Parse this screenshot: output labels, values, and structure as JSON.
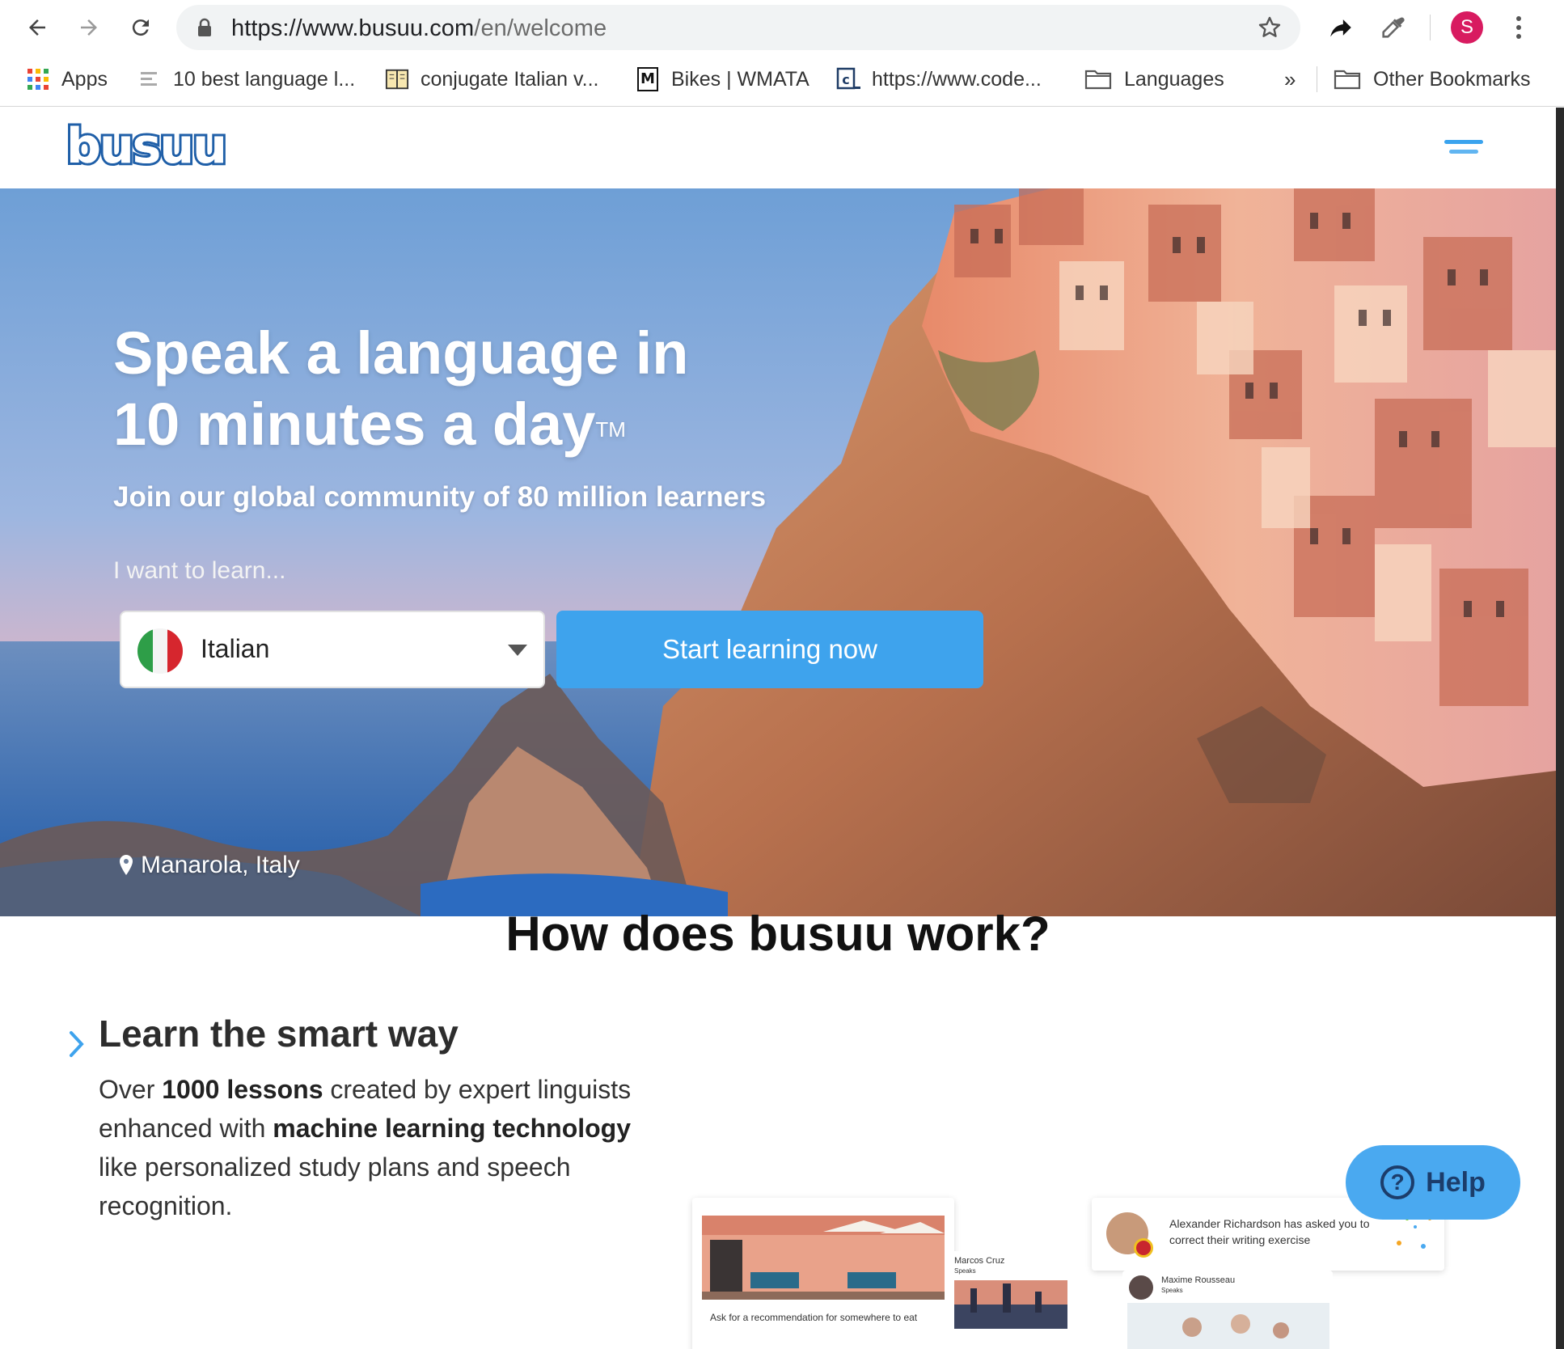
{
  "browser": {
    "url_host": "https://www.busuu.com",
    "url_path": "/en/welcome",
    "profile_initial": "S",
    "bookmarks": [
      {
        "label": "Apps",
        "icon": "apps-grid-icon"
      },
      {
        "label": "10 best language l...",
        "icon": "page-icon"
      },
      {
        "label": "conjugate Italian v...",
        "icon": "book-icon"
      },
      {
        "label": "Bikes | WMATA",
        "icon": "metro-icon"
      },
      {
        "label": "https://www.code...",
        "icon": "codecademy-icon"
      },
      {
        "label": "Languages",
        "icon": "folder-icon"
      }
    ],
    "overflow_label": "»",
    "other_bookmarks": "Other Bookmarks"
  },
  "site": {
    "logo": "busuu",
    "hero": {
      "title_line1": "Speak a language in",
      "title_line2": "10 minutes a day",
      "trademark": "TM",
      "subtitle": "Join our global community of 80 million learners",
      "learn_label": "I want to learn...",
      "language_selected": "Italian",
      "cta_label": "Start learning now",
      "location": "Manarola, Italy"
    },
    "how": {
      "title": "How does busuu work?",
      "feature_title": "Learn the smart way",
      "body_1": "Over ",
      "body_2": "1000 lessons",
      "body_3": " created by expert linguists enhanced with ",
      "body_4": "machine learning technology",
      "body_5": " like personalized study plans and speech recognition."
    },
    "cards": {
      "ask_text": "Ask for a recommendation for somewhere to eat",
      "user1_name": "Marcos Cruz",
      "user1_speaks": "Speaks",
      "notification": "Alexander Richardson has asked you to correct their writing exercise",
      "user2_name": "Maxime Rousseau",
      "user2_speaks": "Speaks"
    },
    "help_label": "Help"
  },
  "colors": {
    "brand_blue": "#3ea3ed",
    "logo_dark": "#1f5fa8",
    "help_bg": "#4aa9f0"
  }
}
